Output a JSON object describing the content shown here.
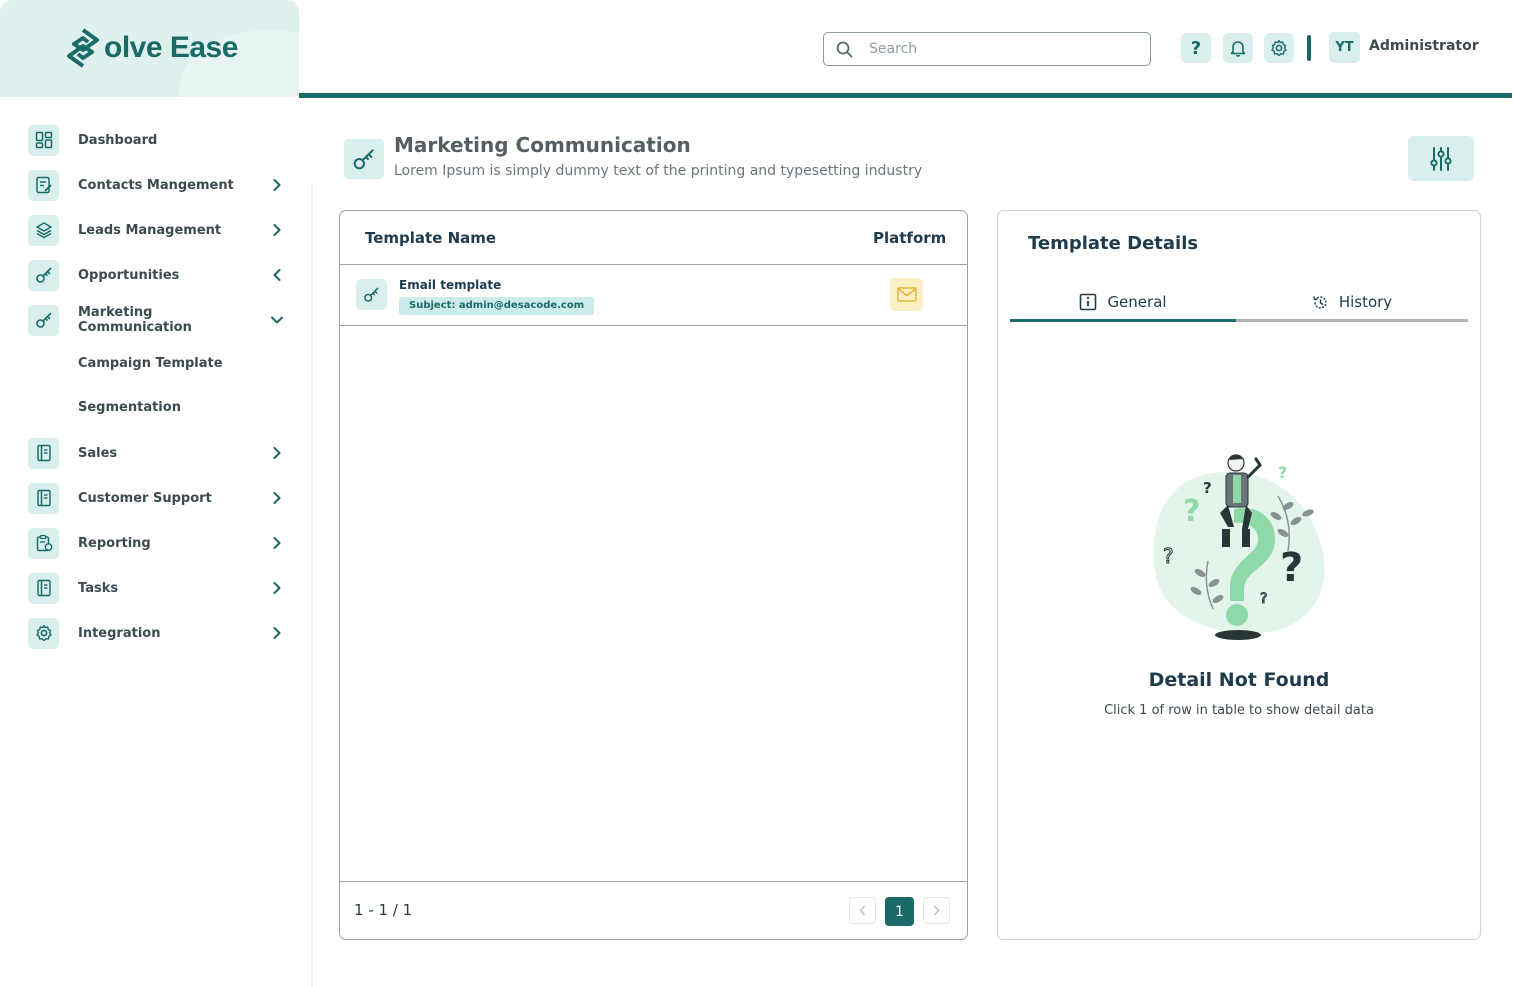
{
  "brand": {
    "name": "olve Ease",
    "color": "#1a6b68"
  },
  "header": {
    "search_placeholder": "Search",
    "help_label": "?",
    "avatar_initials": "YT",
    "username": "Administrator"
  },
  "sidebar": {
    "items": [
      {
        "label": "Dashboard",
        "icon": "dashboard-icon"
      },
      {
        "label": "Contacts Mangement",
        "icon": "contacts-icon"
      },
      {
        "label": "Leads Management",
        "icon": "layers-icon"
      },
      {
        "label": "Opportunities",
        "icon": "key-icon"
      },
      {
        "label": "Marketing Communication",
        "icon": "key-icon"
      },
      {
        "label": "Sales",
        "icon": "document-icon"
      },
      {
        "label": "Customer Support",
        "icon": "document-icon"
      },
      {
        "label": "Reporting",
        "icon": "clipboard-icon"
      },
      {
        "label": "Tasks",
        "icon": "document-icon"
      },
      {
        "label": "Integration",
        "icon": "gear-icon"
      }
    ],
    "subitems": [
      "Campaign Template",
      "Segmentation"
    ]
  },
  "page": {
    "title": "Marketing Communication",
    "subtitle": "Lorem Ipsum is simply dummy text of the printing and typesetting industry"
  },
  "table": {
    "columns": [
      "Template Name",
      "Platform"
    ],
    "rows": [
      {
        "name": "Email template",
        "subject": "Subject: admin@desacode.com",
        "platform_icon": "mail-icon"
      }
    ],
    "range": "1 - 1 / 1",
    "current_page": "1"
  },
  "details": {
    "title": "Template Details",
    "tabs": [
      "General",
      "History"
    ],
    "empty_title": "Detail Not Found",
    "empty_subtitle": "Click 1 of row in table to show detail data"
  }
}
